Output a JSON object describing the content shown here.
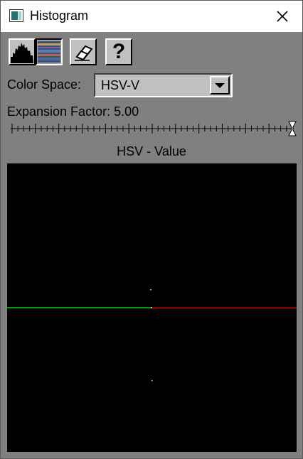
{
  "window": {
    "title": "Histogram"
  },
  "toolbar": {
    "histogram_tool": "histogram-mode",
    "image_tool": "image-mode",
    "eraser_tool": "clear",
    "help_label": "?"
  },
  "color_space": {
    "label": "Color Space:",
    "value": "HSV-V"
  },
  "expansion": {
    "label": "Expansion Factor:",
    "value": "5.00",
    "position": 1.0
  },
  "plot": {
    "title": "HSV - Value",
    "left_line_color": "#00ff00",
    "right_line_color": "#ff0000",
    "background": "#000000"
  }
}
